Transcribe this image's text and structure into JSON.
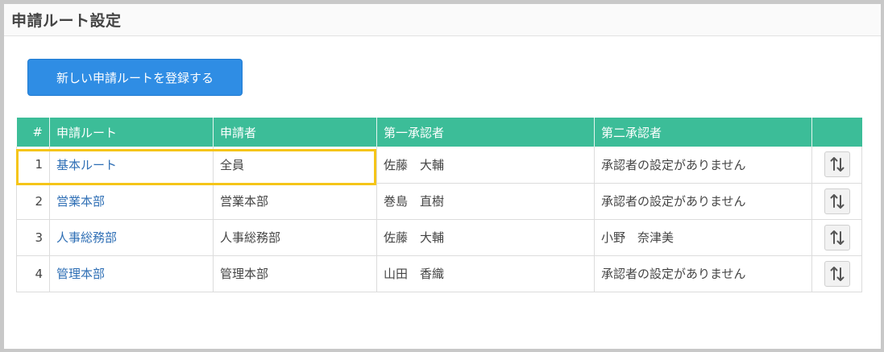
{
  "page": {
    "title": "申請ルート設定"
  },
  "toolbar": {
    "register_label": "新しい申請ルートを登録する"
  },
  "table": {
    "columns": [
      "#",
      "申請ルート",
      "申請者",
      "第一承認者",
      "第二承認者",
      ""
    ],
    "rows": [
      {
        "num": "1",
        "route": "基本ルート",
        "applicant": "全員",
        "first": "佐藤　大輔",
        "second": "承認者の設定がありません",
        "second_empty": true
      },
      {
        "num": "2",
        "route": "営業本部",
        "applicant": "営業本部",
        "first": "巻島　直樹",
        "second": "承認者の設定がありません",
        "second_empty": true
      },
      {
        "num": "3",
        "route": "人事総務部",
        "applicant": "人事総務部",
        "first": "佐藤　大輔",
        "second": "小野　奈津美",
        "second_empty": false
      },
      {
        "num": "4",
        "route": "管理本部",
        "applicant": "管理本部",
        "first": "山田　香織",
        "second": "承認者の設定がありません",
        "second_empty": true
      }
    ]
  },
  "icons": {
    "sort": "sort-arrows-icon"
  },
  "colors": {
    "header_bg": "#3cbd98",
    "primary_button": "#2f8de4",
    "link": "#2f6fb5",
    "highlight": "#f5c518",
    "muted_text": "#b3b3b3"
  }
}
